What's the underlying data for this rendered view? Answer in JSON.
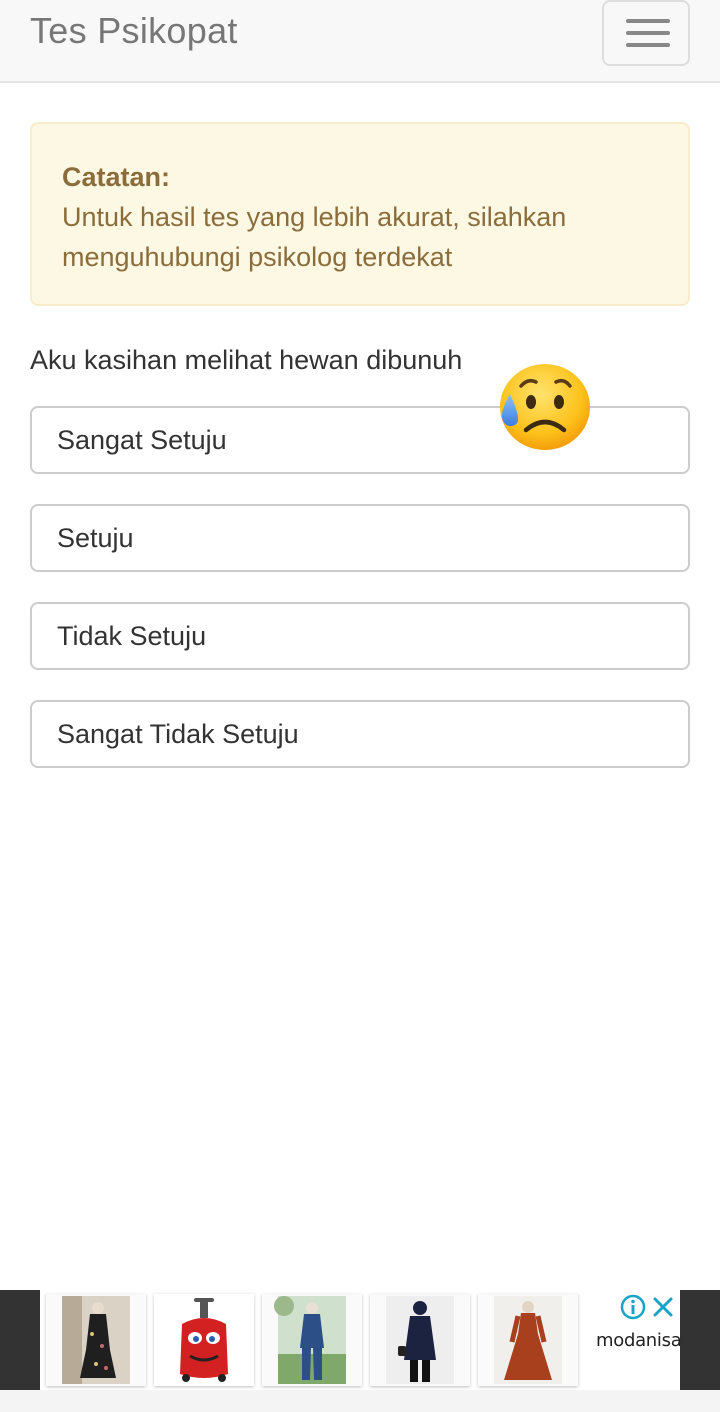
{
  "navbar": {
    "brand": "Tes Psikopat",
    "menu_icon": "hamburger-menu-icon"
  },
  "alert": {
    "title": "Catatan:",
    "message": "Untuk hasil tes yang lebih akurat, silahkan menguhubungi psikolog terdekat",
    "color": "#8a6d3b",
    "background": "#fcf8e3"
  },
  "quiz": {
    "question": "Aku kasihan melihat hewan dibunuh",
    "emoji_icon": "sad-but-relieved-face-icon",
    "options": [
      "Sangat Setuju",
      "Setuju",
      "Tidak Setuju",
      "Sangat Tidak Setuju"
    ]
  },
  "ad": {
    "brand": "modanisa",
    "info_icon": "info-icon",
    "close_icon": "close-icon",
    "accent": "#1aa3c8",
    "products": [
      "floral-dress-image",
      "kids-car-backpack-image",
      "denim-suit-image",
      "navy-tunic-image",
      "rust-maxi-dress-image"
    ]
  }
}
